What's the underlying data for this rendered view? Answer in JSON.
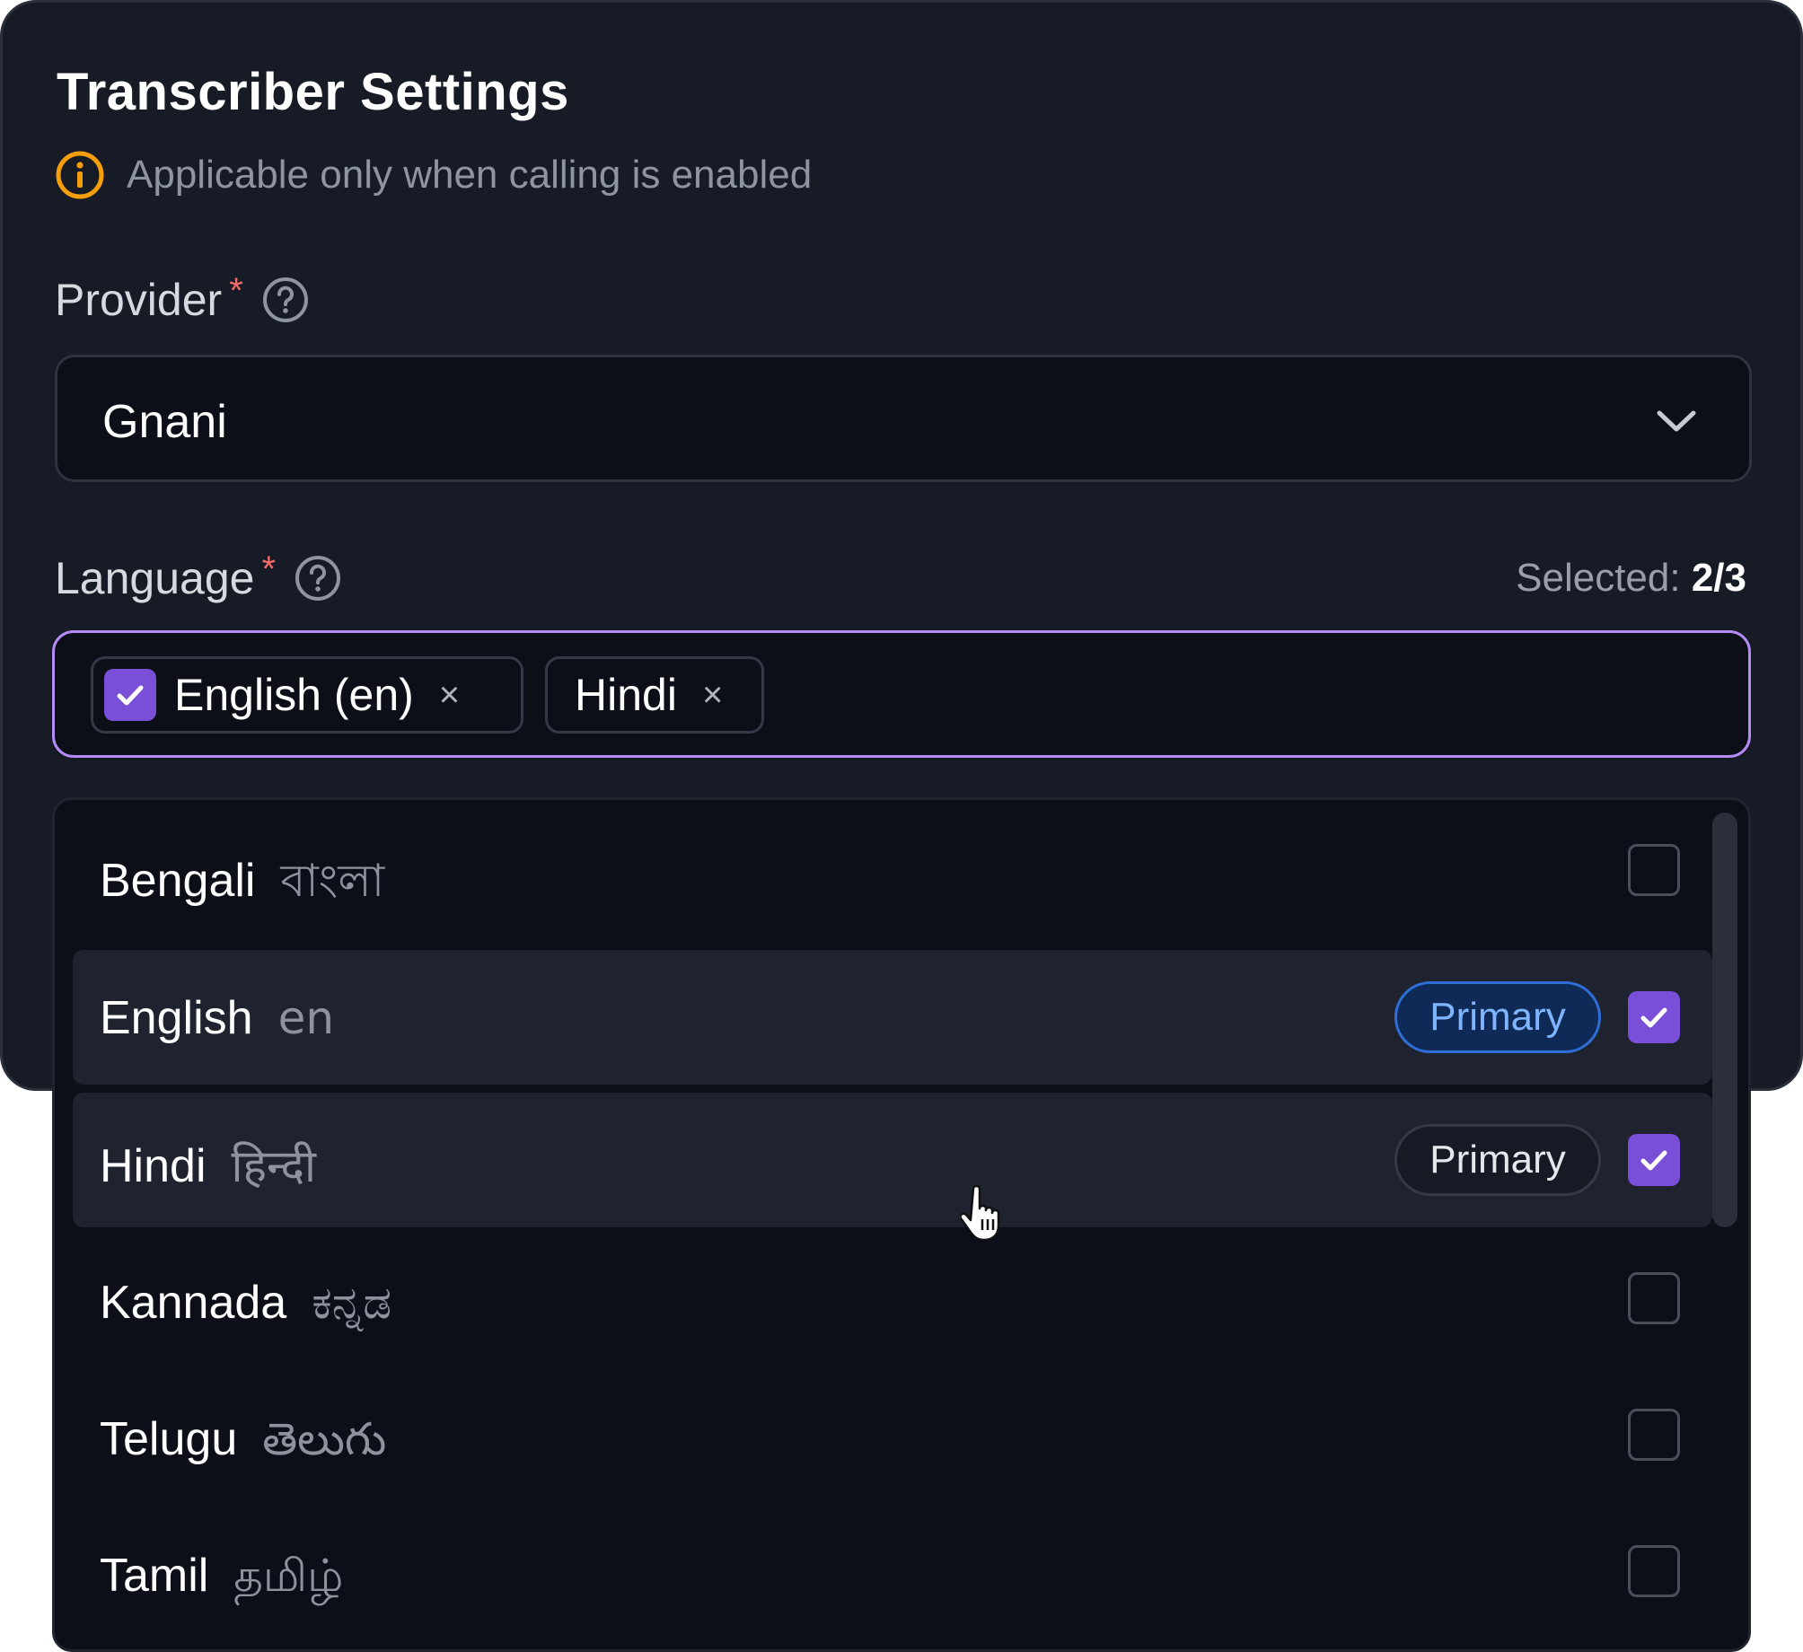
{
  "title": "Transcriber Settings",
  "info": {
    "icon": "info-icon",
    "text": "Applicable only when calling is enabled"
  },
  "provider": {
    "label": "Provider",
    "required_mark": "*",
    "value": "Gnani"
  },
  "language": {
    "label": "Language",
    "required_mark": "*",
    "selected_label": "Selected:",
    "selected_value": "2/3",
    "chips": [
      {
        "label": "English (en)",
        "remove": "×"
      },
      {
        "label": "Hindi",
        "remove": "×"
      }
    ]
  },
  "options": [
    {
      "name": "Bengali",
      "native": "বাংলা",
      "checked": false
    },
    {
      "name": "English",
      "native": "en",
      "badge": "Primary",
      "checked": true
    },
    {
      "name": "Hindi",
      "native": "हिन्दी",
      "badge": "Primary",
      "checked": true
    },
    {
      "name": "Kannada",
      "native": "ಕನ್ನಡ",
      "checked": false
    },
    {
      "name": "Telugu",
      "native": "తెలుగు",
      "checked": false
    },
    {
      "name": "Tamil",
      "native": "தமிழ்",
      "checked": false
    }
  ],
  "colors": {
    "accent": "#7a4fd8",
    "focus_border": "#b48cf5",
    "primary_badge": "#2f6ed6",
    "info_icon": "#f59e0b",
    "required": "#f26b6b"
  }
}
